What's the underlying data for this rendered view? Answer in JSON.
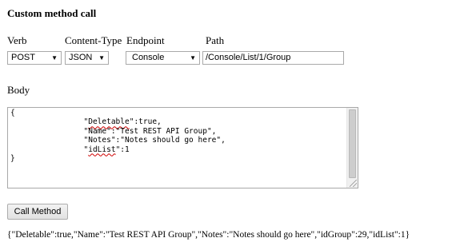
{
  "title": "Custom method call",
  "labels": {
    "verb": "Verb",
    "content_type": "Content-Type",
    "endpoint": "Endpoint",
    "path": "Path",
    "body": "Body"
  },
  "verb_select": {
    "value": "POST",
    "arrow": "▼"
  },
  "content_type_select": {
    "value": "JSON",
    "arrow": "▼"
  },
  "endpoint_select": {
    "value": "Console",
    "arrow": "▼"
  },
  "path_input": {
    "value": "/Console/List/1/Group"
  },
  "body_text": {
    "open": "{",
    "line1_pre": "                \"",
    "line1_word": "Deletable",
    "line1_post": "\":true,",
    "line2": "                \"Name\":\"Test REST API Group\",",
    "line3": "                \"Notes\":\"Notes should go here\",",
    "line4_pre": "                \"",
    "line4_word": "idList",
    "line4_post": "\":1",
    "close": "}"
  },
  "call_button": {
    "label": "Call Method"
  },
  "result_text": "{\"Deletable\":true,\"Name\":\"Test REST API Group\",\"Notes\":\"Notes should go here\",\"idGroup\":29,\"idList\":1}"
}
